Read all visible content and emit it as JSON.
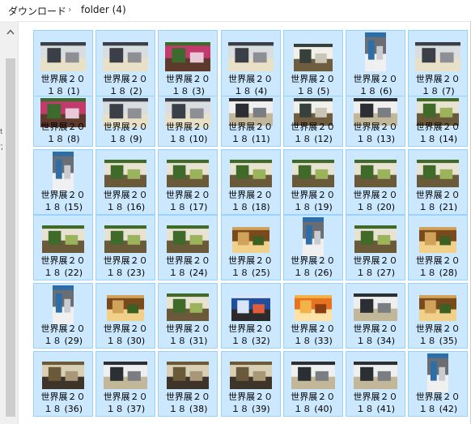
{
  "breadcrumb": {
    "segments": [
      "ダウンロード",
      "folder (4)"
    ],
    "separator": "›"
  },
  "scrollbar": {
    "up_arrow_icon": "chevron-up-icon"
  },
  "left_edge_marks": [
    "t",
    "7"
  ],
  "files": [
    {
      "name_line1": "世界展２０",
      "name_line2": "１８ (1)",
      "scene": "hall"
    },
    {
      "name_line1": "世界展２０",
      "name_line2": "１８ (2)",
      "scene": "hall"
    },
    {
      "name_line1": "世界展２０",
      "name_line2": "１８ (3)",
      "scene": "flowers"
    },
    {
      "name_line1": "世界展２０",
      "name_line2": "１８ (4)",
      "scene": "hall"
    },
    {
      "name_line1": "世界展２０",
      "name_line2": "１８ (5)",
      "scene": "stage"
    },
    {
      "name_line1": "世界展２０",
      "name_line2": "１８ (6)",
      "scene": "tall"
    },
    {
      "name_line1": "世界展２０",
      "name_line2": "１８ (7)",
      "scene": "hall"
    },
    {
      "name_line1": "世界展２０",
      "name_line2": "１８ (8)",
      "scene": "flowers"
    },
    {
      "name_line1": "世界展２０",
      "name_line2": "１８ (9)",
      "scene": "hall"
    },
    {
      "name_line1": "世界展２０",
      "name_line2": "１８ (10)",
      "scene": "hall"
    },
    {
      "name_line1": "世界展２０",
      "name_line2": "１８ (11)",
      "scene": "crowd"
    },
    {
      "name_line1": "世界展２０",
      "name_line2": "１８ (12)",
      "scene": "stage"
    },
    {
      "name_line1": "世界展２０",
      "name_line2": "１８ (13)",
      "scene": "crowd"
    },
    {
      "name_line1": "世界展２０",
      "name_line2": "１８ (14)",
      "scene": "plant"
    },
    {
      "name_line1": "世界展２０",
      "name_line2": "１８ (15)",
      "scene": "tall"
    },
    {
      "name_line1": "世界展２０",
      "name_line2": "１８ (16)",
      "scene": "plant"
    },
    {
      "name_line1": "世界展２０",
      "name_line2": "１８ (17)",
      "scene": "plant"
    },
    {
      "name_line1": "世界展２０",
      "name_line2": "１８ (18)",
      "scene": "plant"
    },
    {
      "name_line1": "世界展２０",
      "name_line2": "１８ (19)",
      "scene": "plant"
    },
    {
      "name_line1": "世界展２０",
      "name_line2": "１８ (20)",
      "scene": "plant"
    },
    {
      "name_line1": "世界展２０",
      "name_line2": "１８ (21)",
      "scene": "plant"
    },
    {
      "name_line1": "世界展２０",
      "name_line2": "１８ (22)",
      "scene": "plant"
    },
    {
      "name_line1": "世界展２０",
      "name_line2": "１８ (23)",
      "scene": "plant"
    },
    {
      "name_line1": "世界展２０",
      "name_line2": "１８ (24)",
      "scene": "plant"
    },
    {
      "name_line1": "世界展２０",
      "name_line2": "１８ (25)",
      "scene": "warm"
    },
    {
      "name_line1": "世界展２０",
      "name_line2": "１８ (26)",
      "scene": "tall"
    },
    {
      "name_line1": "世界展２０",
      "name_line2": "１８ (27)",
      "scene": "plant"
    },
    {
      "name_line1": "世界展２０",
      "name_line2": "１８ (28)",
      "scene": "warm"
    },
    {
      "name_line1": "世界展２０",
      "name_line2": "１８ (29)",
      "scene": "tall"
    },
    {
      "name_line1": "世界展２０",
      "name_line2": "１８ (30)",
      "scene": "warm"
    },
    {
      "name_line1": "世界展２０",
      "name_line2": "１８ (31)",
      "scene": "plant"
    },
    {
      "name_line1": "世界展２０",
      "name_line2": "１８ (32)",
      "scene": "blue"
    },
    {
      "name_line1": "世界展２０",
      "name_line2": "１８ (33)",
      "scene": "orange"
    },
    {
      "name_line1": "世界展２０",
      "name_line2": "１８ (34)",
      "scene": "crowd"
    },
    {
      "name_line1": "世界展２０",
      "name_line2": "１８ (35)",
      "scene": "warm"
    },
    {
      "name_line1": "世界展２０",
      "name_line2": "１８ (36)",
      "scene": "model"
    },
    {
      "name_line1": "世界展２０",
      "name_line2": "１８ (37)",
      "scene": "crowd"
    },
    {
      "name_line1": "世界展２０",
      "name_line2": "１８ (38)",
      "scene": "model"
    },
    {
      "name_line1": "世界展２０",
      "name_line2": "１８ (39)",
      "scene": "model"
    },
    {
      "name_line1": "世界展２０",
      "name_line2": "１８ (40)",
      "scene": "crowd"
    },
    {
      "name_line1": "世界展２０",
      "name_line2": "１８ (41)",
      "scene": "crowd"
    },
    {
      "name_line1": "世界展２０",
      "name_line2": "１８ (42)",
      "scene": "tall"
    }
  ],
  "colors": {
    "selection_fill": "#cce8ff",
    "selection_border": "#99d1ff",
    "text": "#000000"
  }
}
